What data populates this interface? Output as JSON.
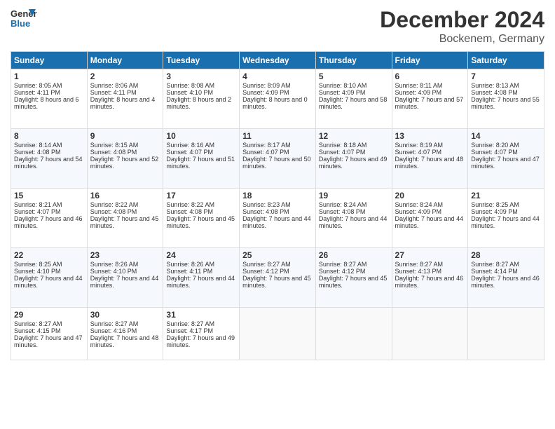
{
  "header": {
    "logo_general": "General",
    "logo_blue": "Blue",
    "month": "December 2024",
    "location": "Bockenem, Germany"
  },
  "days": [
    "Sunday",
    "Monday",
    "Tuesday",
    "Wednesday",
    "Thursday",
    "Friday",
    "Saturday"
  ],
  "cells": [
    [
      {
        "day": "1",
        "sunrise": "Sunrise: 8:05 AM",
        "sunset": "Sunset: 4:11 PM",
        "daylight": "Daylight: 8 hours and 6 minutes."
      },
      {
        "day": "2",
        "sunrise": "Sunrise: 8:06 AM",
        "sunset": "Sunset: 4:11 PM",
        "daylight": "Daylight: 8 hours and 4 minutes."
      },
      {
        "day": "3",
        "sunrise": "Sunrise: 8:08 AM",
        "sunset": "Sunset: 4:10 PM",
        "daylight": "Daylight: 8 hours and 2 minutes."
      },
      {
        "day": "4",
        "sunrise": "Sunrise: 8:09 AM",
        "sunset": "Sunset: 4:09 PM",
        "daylight": "Daylight: 8 hours and 0 minutes."
      },
      {
        "day": "5",
        "sunrise": "Sunrise: 8:10 AM",
        "sunset": "Sunset: 4:09 PM",
        "daylight": "Daylight: 7 hours and 58 minutes."
      },
      {
        "day": "6",
        "sunrise": "Sunrise: 8:11 AM",
        "sunset": "Sunset: 4:09 PM",
        "daylight": "Daylight: 7 hours and 57 minutes."
      },
      {
        "day": "7",
        "sunrise": "Sunrise: 8:13 AM",
        "sunset": "Sunset: 4:08 PM",
        "daylight": "Daylight: 7 hours and 55 minutes."
      }
    ],
    [
      {
        "day": "8",
        "sunrise": "Sunrise: 8:14 AM",
        "sunset": "Sunset: 4:08 PM",
        "daylight": "Daylight: 7 hours and 54 minutes."
      },
      {
        "day": "9",
        "sunrise": "Sunrise: 8:15 AM",
        "sunset": "Sunset: 4:08 PM",
        "daylight": "Daylight: 7 hours and 52 minutes."
      },
      {
        "day": "10",
        "sunrise": "Sunrise: 8:16 AM",
        "sunset": "Sunset: 4:07 PM",
        "daylight": "Daylight: 7 hours and 51 minutes."
      },
      {
        "day": "11",
        "sunrise": "Sunrise: 8:17 AM",
        "sunset": "Sunset: 4:07 PM",
        "daylight": "Daylight: 7 hours and 50 minutes."
      },
      {
        "day": "12",
        "sunrise": "Sunrise: 8:18 AM",
        "sunset": "Sunset: 4:07 PM",
        "daylight": "Daylight: 7 hours and 49 minutes."
      },
      {
        "day": "13",
        "sunrise": "Sunrise: 8:19 AM",
        "sunset": "Sunset: 4:07 PM",
        "daylight": "Daylight: 7 hours and 48 minutes."
      },
      {
        "day": "14",
        "sunrise": "Sunrise: 8:20 AM",
        "sunset": "Sunset: 4:07 PM",
        "daylight": "Daylight: 7 hours and 47 minutes."
      }
    ],
    [
      {
        "day": "15",
        "sunrise": "Sunrise: 8:21 AM",
        "sunset": "Sunset: 4:07 PM",
        "daylight": "Daylight: 7 hours and 46 minutes."
      },
      {
        "day": "16",
        "sunrise": "Sunrise: 8:22 AM",
        "sunset": "Sunset: 4:08 PM",
        "daylight": "Daylight: 7 hours and 45 minutes."
      },
      {
        "day": "17",
        "sunrise": "Sunrise: 8:22 AM",
        "sunset": "Sunset: 4:08 PM",
        "daylight": "Daylight: 7 hours and 45 minutes."
      },
      {
        "day": "18",
        "sunrise": "Sunrise: 8:23 AM",
        "sunset": "Sunset: 4:08 PM",
        "daylight": "Daylight: 7 hours and 44 minutes."
      },
      {
        "day": "19",
        "sunrise": "Sunrise: 8:24 AM",
        "sunset": "Sunset: 4:08 PM",
        "daylight": "Daylight: 7 hours and 44 minutes."
      },
      {
        "day": "20",
        "sunrise": "Sunrise: 8:24 AM",
        "sunset": "Sunset: 4:09 PM",
        "daylight": "Daylight: 7 hours and 44 minutes."
      },
      {
        "day": "21",
        "sunrise": "Sunrise: 8:25 AM",
        "sunset": "Sunset: 4:09 PM",
        "daylight": "Daylight: 7 hours and 44 minutes."
      }
    ],
    [
      {
        "day": "22",
        "sunrise": "Sunrise: 8:25 AM",
        "sunset": "Sunset: 4:10 PM",
        "daylight": "Daylight: 7 hours and 44 minutes."
      },
      {
        "day": "23",
        "sunrise": "Sunrise: 8:26 AM",
        "sunset": "Sunset: 4:10 PM",
        "daylight": "Daylight: 7 hours and 44 minutes."
      },
      {
        "day": "24",
        "sunrise": "Sunrise: 8:26 AM",
        "sunset": "Sunset: 4:11 PM",
        "daylight": "Daylight: 7 hours and 44 minutes."
      },
      {
        "day": "25",
        "sunrise": "Sunrise: 8:27 AM",
        "sunset": "Sunset: 4:12 PM",
        "daylight": "Daylight: 7 hours and 45 minutes."
      },
      {
        "day": "26",
        "sunrise": "Sunrise: 8:27 AM",
        "sunset": "Sunset: 4:12 PM",
        "daylight": "Daylight: 7 hours and 45 minutes."
      },
      {
        "day": "27",
        "sunrise": "Sunrise: 8:27 AM",
        "sunset": "Sunset: 4:13 PM",
        "daylight": "Daylight: 7 hours and 46 minutes."
      },
      {
        "day": "28",
        "sunrise": "Sunrise: 8:27 AM",
        "sunset": "Sunset: 4:14 PM",
        "daylight": "Daylight: 7 hours and 46 minutes."
      }
    ],
    [
      {
        "day": "29",
        "sunrise": "Sunrise: 8:27 AM",
        "sunset": "Sunset: 4:15 PM",
        "daylight": "Daylight: 7 hours and 47 minutes."
      },
      {
        "day": "30",
        "sunrise": "Sunrise: 8:27 AM",
        "sunset": "Sunset: 4:16 PM",
        "daylight": "Daylight: 7 hours and 48 minutes."
      },
      {
        "day": "31",
        "sunrise": "Sunrise: 8:27 AM",
        "sunset": "Sunset: 4:17 PM",
        "daylight": "Daylight: 7 hours and 49 minutes."
      },
      null,
      null,
      null,
      null
    ]
  ]
}
